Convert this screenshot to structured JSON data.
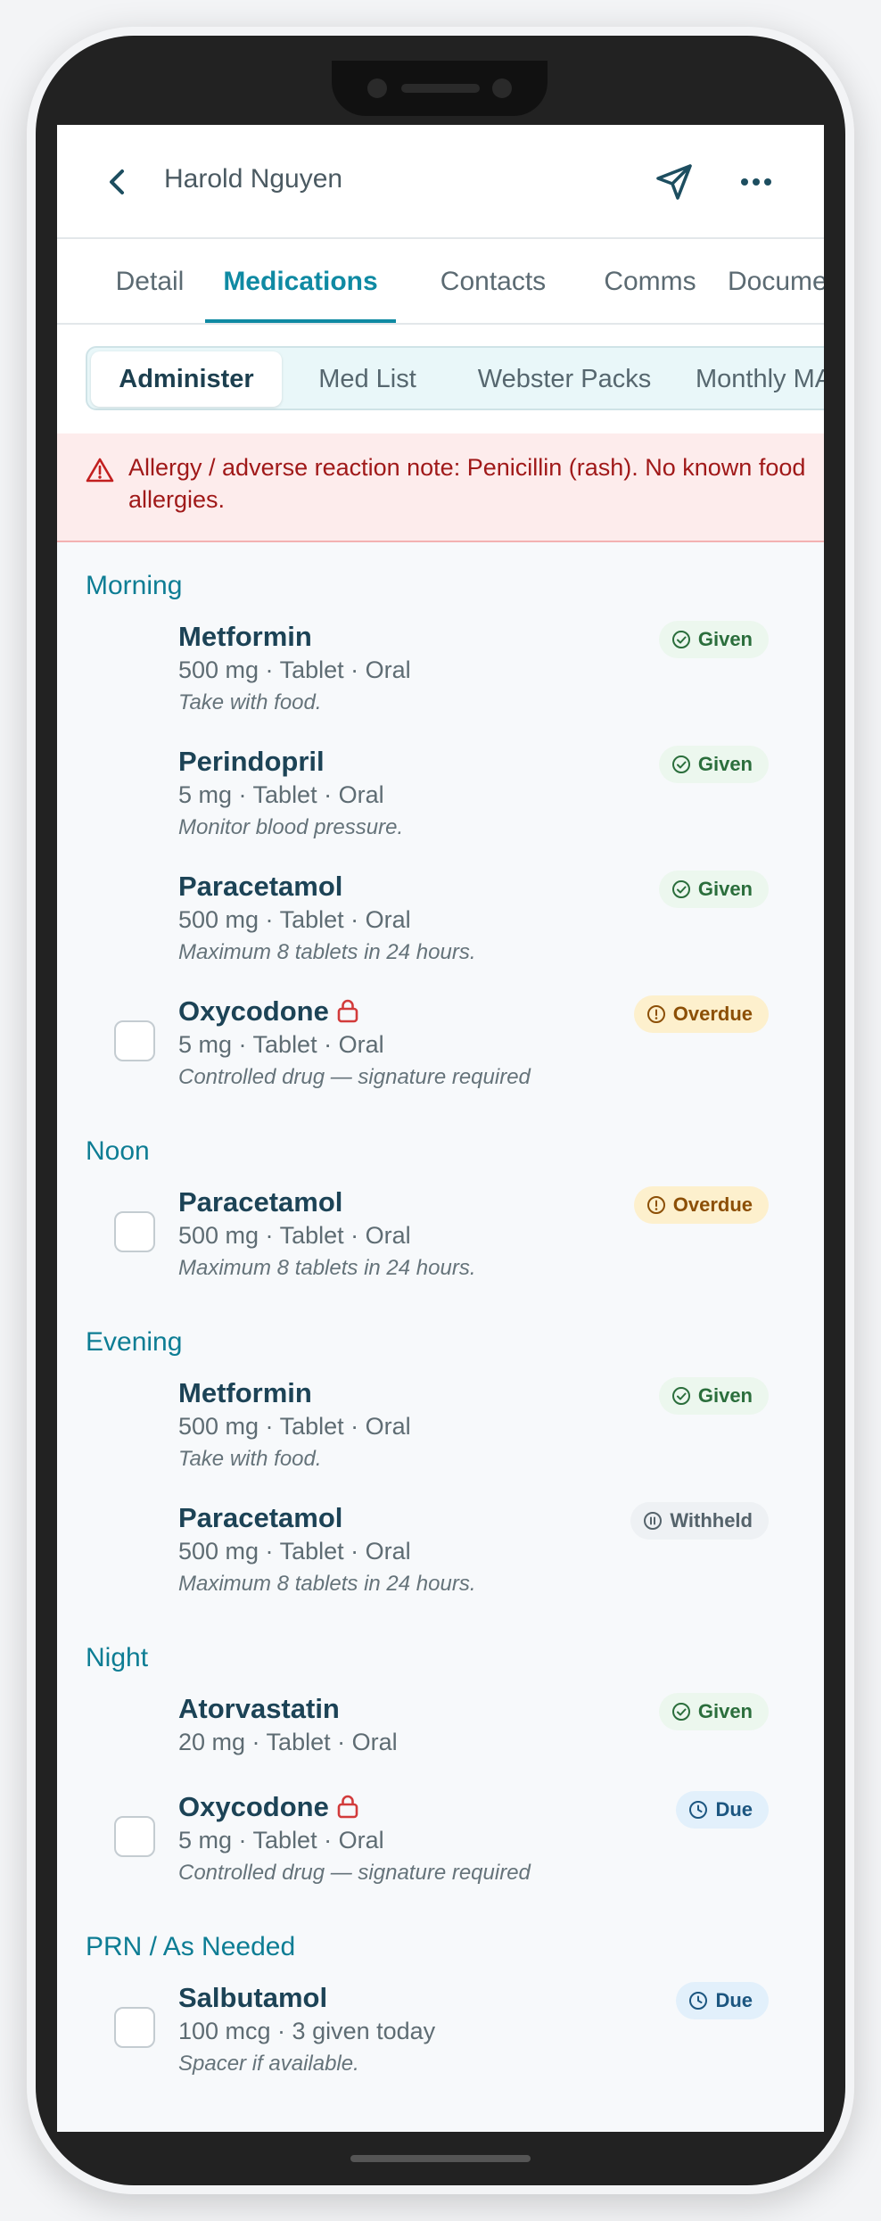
{
  "header": {
    "title": "Harold Nguyen"
  },
  "tabs": [
    {
      "label": "Detail"
    },
    {
      "label": "Medications",
      "active": true
    },
    {
      "label": "Contacts"
    },
    {
      "label": "Comms"
    },
    {
      "label": "Documents"
    }
  ],
  "subtabs": [
    {
      "label": "Administer",
      "active": true
    },
    {
      "label": "Med List"
    },
    {
      "label": "Webster Packs"
    },
    {
      "label": "Monthly MAR"
    }
  ],
  "allergy": {
    "text": "Allergy / adverse reaction note: Penicillin (rash). No known food allergies."
  },
  "sections": [
    {
      "label": "Morning",
      "meds": [
        {
          "name": "Metformin",
          "detail": "500 mg · Tablet · Oral",
          "note": "Take with food.",
          "status": "Given",
          "checkbox": false,
          "controlled": false
        },
        {
          "name": "Perindopril",
          "detail": "5 mg · Tablet · Oral",
          "note": "Monitor blood pressure.",
          "status": "Given",
          "checkbox": false,
          "controlled": false
        },
        {
          "name": "Paracetamol",
          "detail": "500 mg · Tablet · Oral",
          "note": "Maximum 8 tablets in 24 hours.",
          "status": "Given",
          "checkbox": false,
          "controlled": false
        },
        {
          "name": "Oxycodone",
          "detail": "5 mg · Tablet · Oral",
          "note": "Controlled drug — signature required",
          "status": "Overdue",
          "checkbox": true,
          "controlled": true
        }
      ]
    },
    {
      "label": "Noon",
      "meds": [
        {
          "name": "Paracetamol",
          "detail": "500 mg · Tablet · Oral",
          "note": "Maximum 8 tablets in 24 hours.",
          "status": "Overdue",
          "checkbox": true,
          "controlled": false
        }
      ]
    },
    {
      "label": "Evening",
      "meds": [
        {
          "name": "Metformin",
          "detail": "500 mg · Tablet · Oral",
          "note": "Take with food.",
          "status": "Given",
          "checkbox": false,
          "controlled": false
        },
        {
          "name": "Paracetamol",
          "detail": "500 mg · Tablet · Oral",
          "note": "Maximum 8 tablets in 24 hours.",
          "status": "Withheld",
          "checkbox": false,
          "controlled": false
        }
      ]
    },
    {
      "label": "Night",
      "meds": [
        {
          "name": "Atorvastatin",
          "detail": "20 mg · Tablet · Oral",
          "note": "",
          "status": "Given",
          "checkbox": false,
          "controlled": false
        },
        {
          "name": "Oxycodone",
          "detail": "5 mg · Tablet · Oral",
          "note": "Controlled drug — signature required",
          "status": "Due",
          "checkbox": true,
          "controlled": true
        }
      ]
    },
    {
      "label": "PRN / As Needed",
      "meds": [
        {
          "name": "Salbutamol",
          "detail": "100 mcg · 3 given today",
          "note": "Spacer if available.",
          "status": "Due",
          "checkbox": true,
          "controlled": false
        }
      ]
    }
  ],
  "colors": {
    "accent": "#0f8aa3",
    "given": "#2b6e3c",
    "overdue": "#8c4f06",
    "due": "#1c5680",
    "withheld": "#55636b",
    "allergy": "#a01919"
  }
}
